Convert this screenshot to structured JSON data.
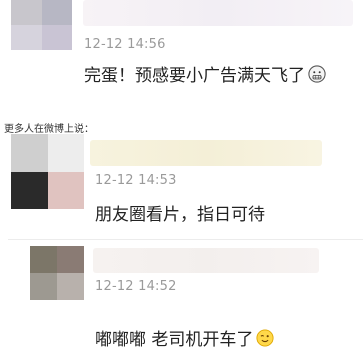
{
  "comments": [
    {
      "time": "12-12 14:56",
      "text": "完蛋！预感要小广告满天飞了",
      "emoji": "grimacing-face-icon",
      "avatar_colors": [
        "#c8c6cc",
        "#b7b7c4",
        "#d6d3dd",
        "#c9c4d4"
      ],
      "name_blur_color": "#f1eef4"
    },
    {
      "time": "12-12 14:53",
      "text": "朋友圈看片，指日可待",
      "emoji": "",
      "avatar_colors": [
        "#cfcfcf",
        "#ececec",
        "#2a2a2a",
        "#e0c3c0"
      ],
      "name_blur_color": "#f6f2dd"
    },
    {
      "time": "12-12 14:52",
      "text": "嘟嘟嘟 老司机开车了",
      "emoji": "winking-face-icon",
      "avatar_colors": [
        "#7c7668",
        "#8a7b74",
        "#9d9991",
        "#b8b1ac"
      ],
      "name_blur_color": "#f5f1ef"
    }
  ],
  "section": {
    "header": "更多人在微博上说："
  }
}
